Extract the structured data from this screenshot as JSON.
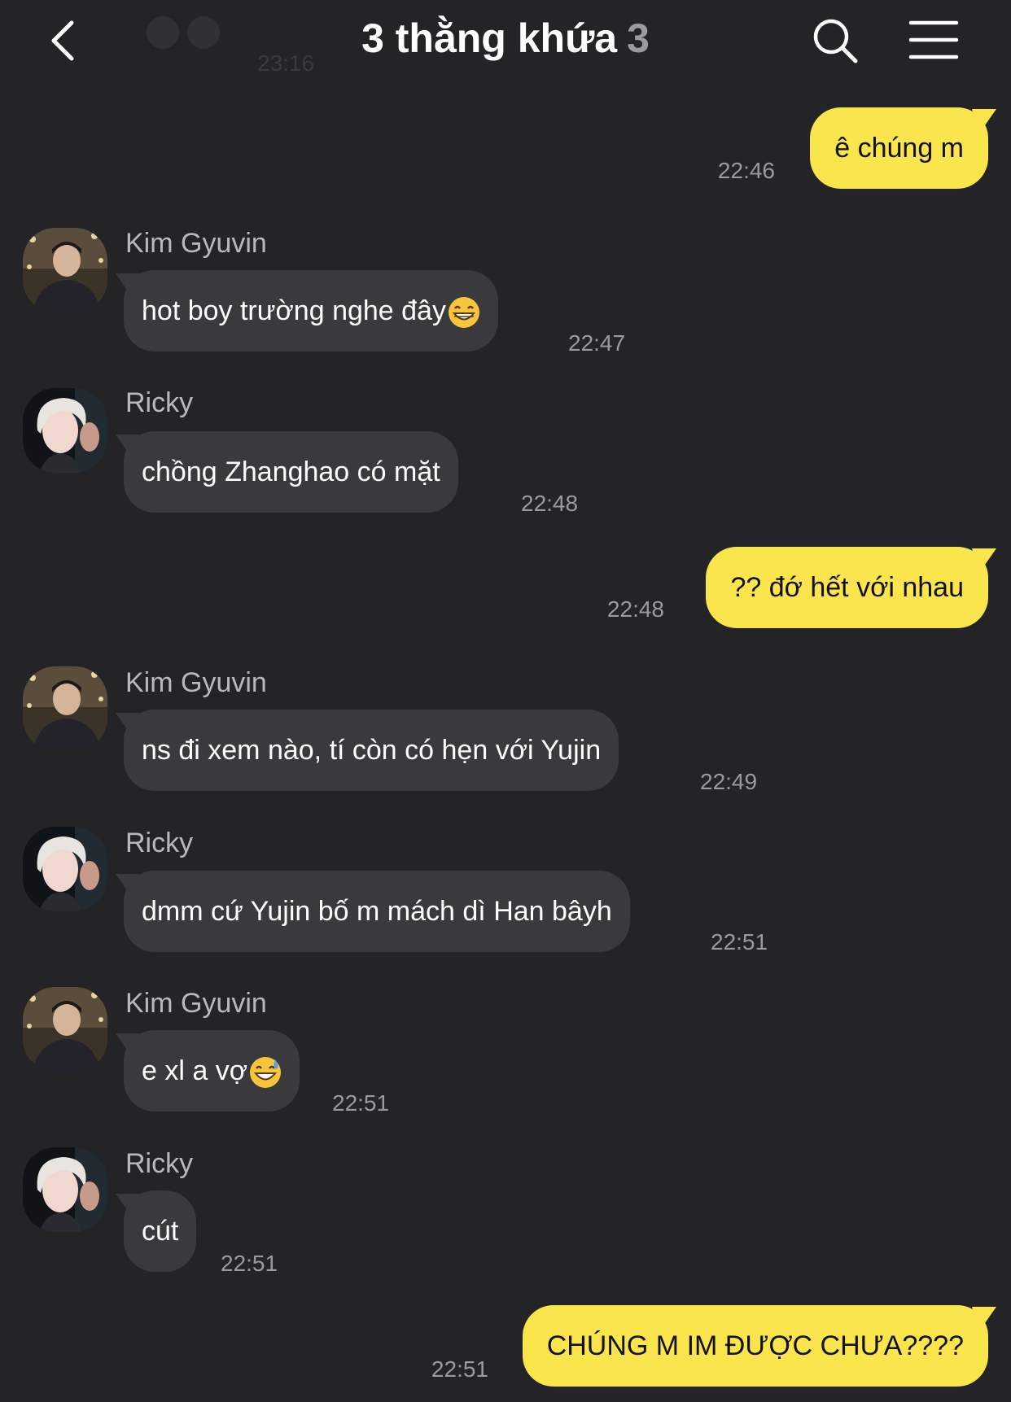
{
  "header": {
    "title": "3 thằng khứa",
    "member_count": "3",
    "back_icon": "chevron-left-icon",
    "search_icon": "search-icon",
    "menu_icon": "hamburger-menu-icon",
    "behind_header_time": "23:16"
  },
  "colors": {
    "background": "#242427",
    "my_bubble": "#fbe54d",
    "their_bubble": "#3a3a3d",
    "secondary_text": "#9b9b9f"
  },
  "messages": [
    {
      "sender": "me",
      "text": "ê chúng m",
      "time": "22:46"
    },
    {
      "sender": "Kim Gyuvin",
      "text": "hot boy trường nghe đây",
      "emoji": "grinning-face-icon",
      "time": "22:47"
    },
    {
      "sender": "Ricky",
      "text": "chồng Zhanghao có mặt",
      "time": "22:48"
    },
    {
      "sender": "me",
      "text": "?? đớ hết với nhau",
      "time": "22:48"
    },
    {
      "sender": "Kim Gyuvin",
      "text": "ns đi xem nào, tí còn có hẹn với Yujin",
      "time": "22:49"
    },
    {
      "sender": "Ricky",
      "text": "dmm cứ Yujin bố m mách dì Han bâyh",
      "time": "22:51"
    },
    {
      "sender": "Kim Gyuvin",
      "text": "e xl a vợ",
      "emoji": "grinning-sweat-icon",
      "time": "22:51"
    },
    {
      "sender": "Ricky",
      "text": "cút",
      "time": "22:51"
    },
    {
      "sender": "me",
      "text": "CHÚNG M IM ĐƯỢC CHƯA????",
      "time": "22:51"
    }
  ]
}
